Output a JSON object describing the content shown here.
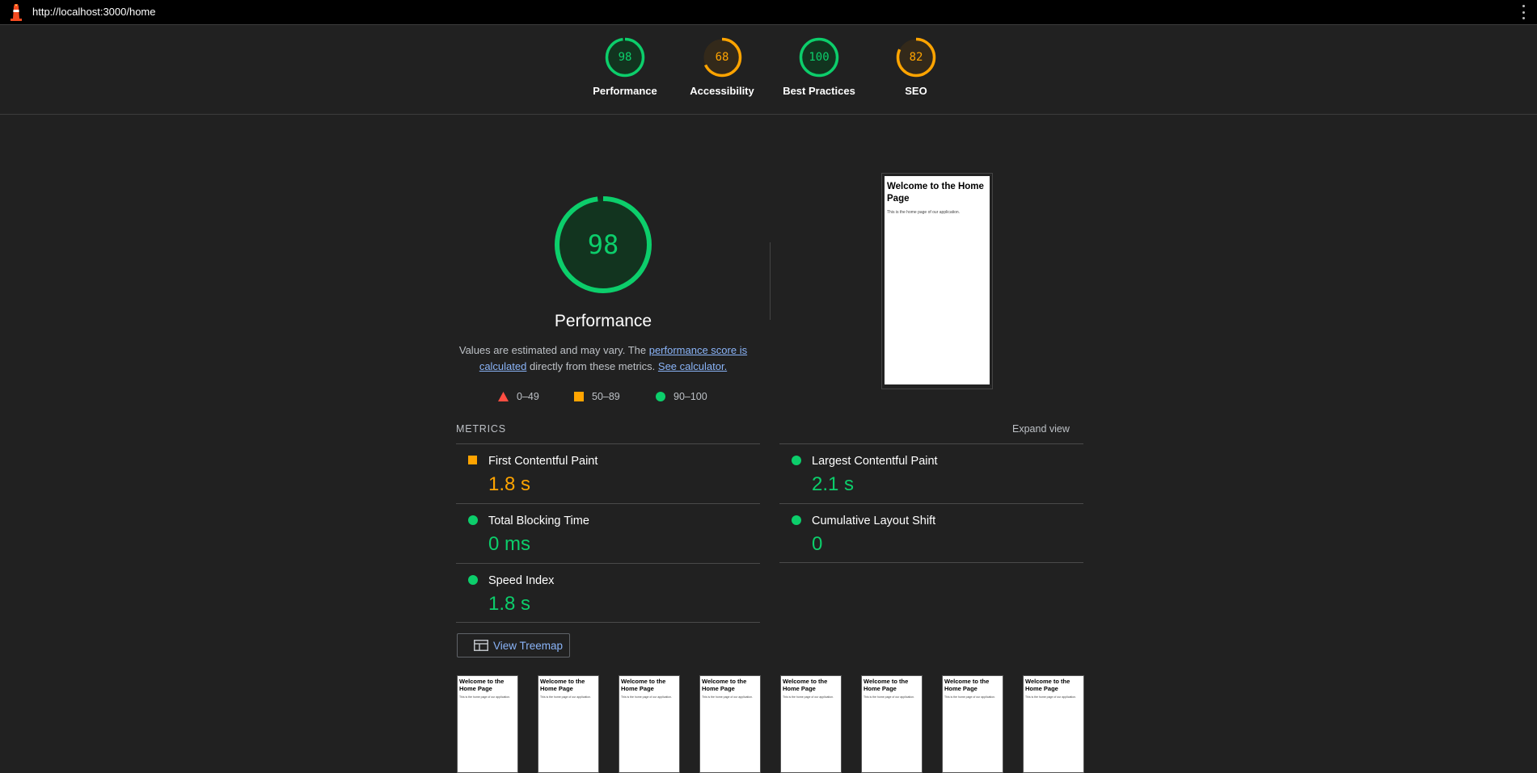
{
  "browser": {
    "url": "http://localhost:3000/home"
  },
  "scores": [
    {
      "label": "Performance",
      "value": "98",
      "pct": 0.98,
      "color": "#0cce6b",
      "bg": "#12341f"
    },
    {
      "label": "Accessibility",
      "value": "68",
      "pct": 0.68,
      "color": "#ffa400",
      "bg": "#33291a"
    },
    {
      "label": "Best Practices",
      "value": "100",
      "pct": 1.0,
      "color": "#0cce6b",
      "bg": "#12341f"
    },
    {
      "label": "SEO",
      "value": "82",
      "pct": 0.82,
      "color": "#ffa400",
      "bg": "#33291a"
    }
  ],
  "performance": {
    "score": "98",
    "pct": 0.98,
    "title": "Performance",
    "desc_prefix": "Values are estimated and may vary. The ",
    "desc_link": "performance score is calculated",
    "desc_middle": " directly from these metrics. ",
    "desc_calc": "See calculator."
  },
  "legend": [
    {
      "shape": "triangle",
      "range": "0–49",
      "color": "#ff4e42"
    },
    {
      "shape": "square",
      "range": "50–89",
      "color": "#ffa400"
    },
    {
      "shape": "circle",
      "range": "90–100",
      "color": "#0cce6b"
    }
  ],
  "page_preview": {
    "heading": "Welcome to the Home Page",
    "body": "This is the home page of our application."
  },
  "metrics_section": {
    "label": "METRICS",
    "expand": "Expand view"
  },
  "metrics": [
    {
      "name": "First Contentful Paint",
      "value": "1.8 s",
      "status": "average",
      "color": "#ffa400"
    },
    {
      "name": "Largest Contentful Paint",
      "value": "2.1 s",
      "status": "pass",
      "color": "#0cce6b"
    },
    {
      "name": "Total Blocking Time",
      "value": "0 ms",
      "status": "pass",
      "color": "#0cce6b"
    },
    {
      "name": "Cumulative Layout Shift",
      "value": "0",
      "status": "pass",
      "color": "#0cce6b"
    },
    {
      "name": "Speed Index",
      "value": "1.8 s",
      "status": "pass",
      "color": "#0cce6b"
    }
  ],
  "treemap_button": "View Treemap",
  "filmstrip_count": 8
}
